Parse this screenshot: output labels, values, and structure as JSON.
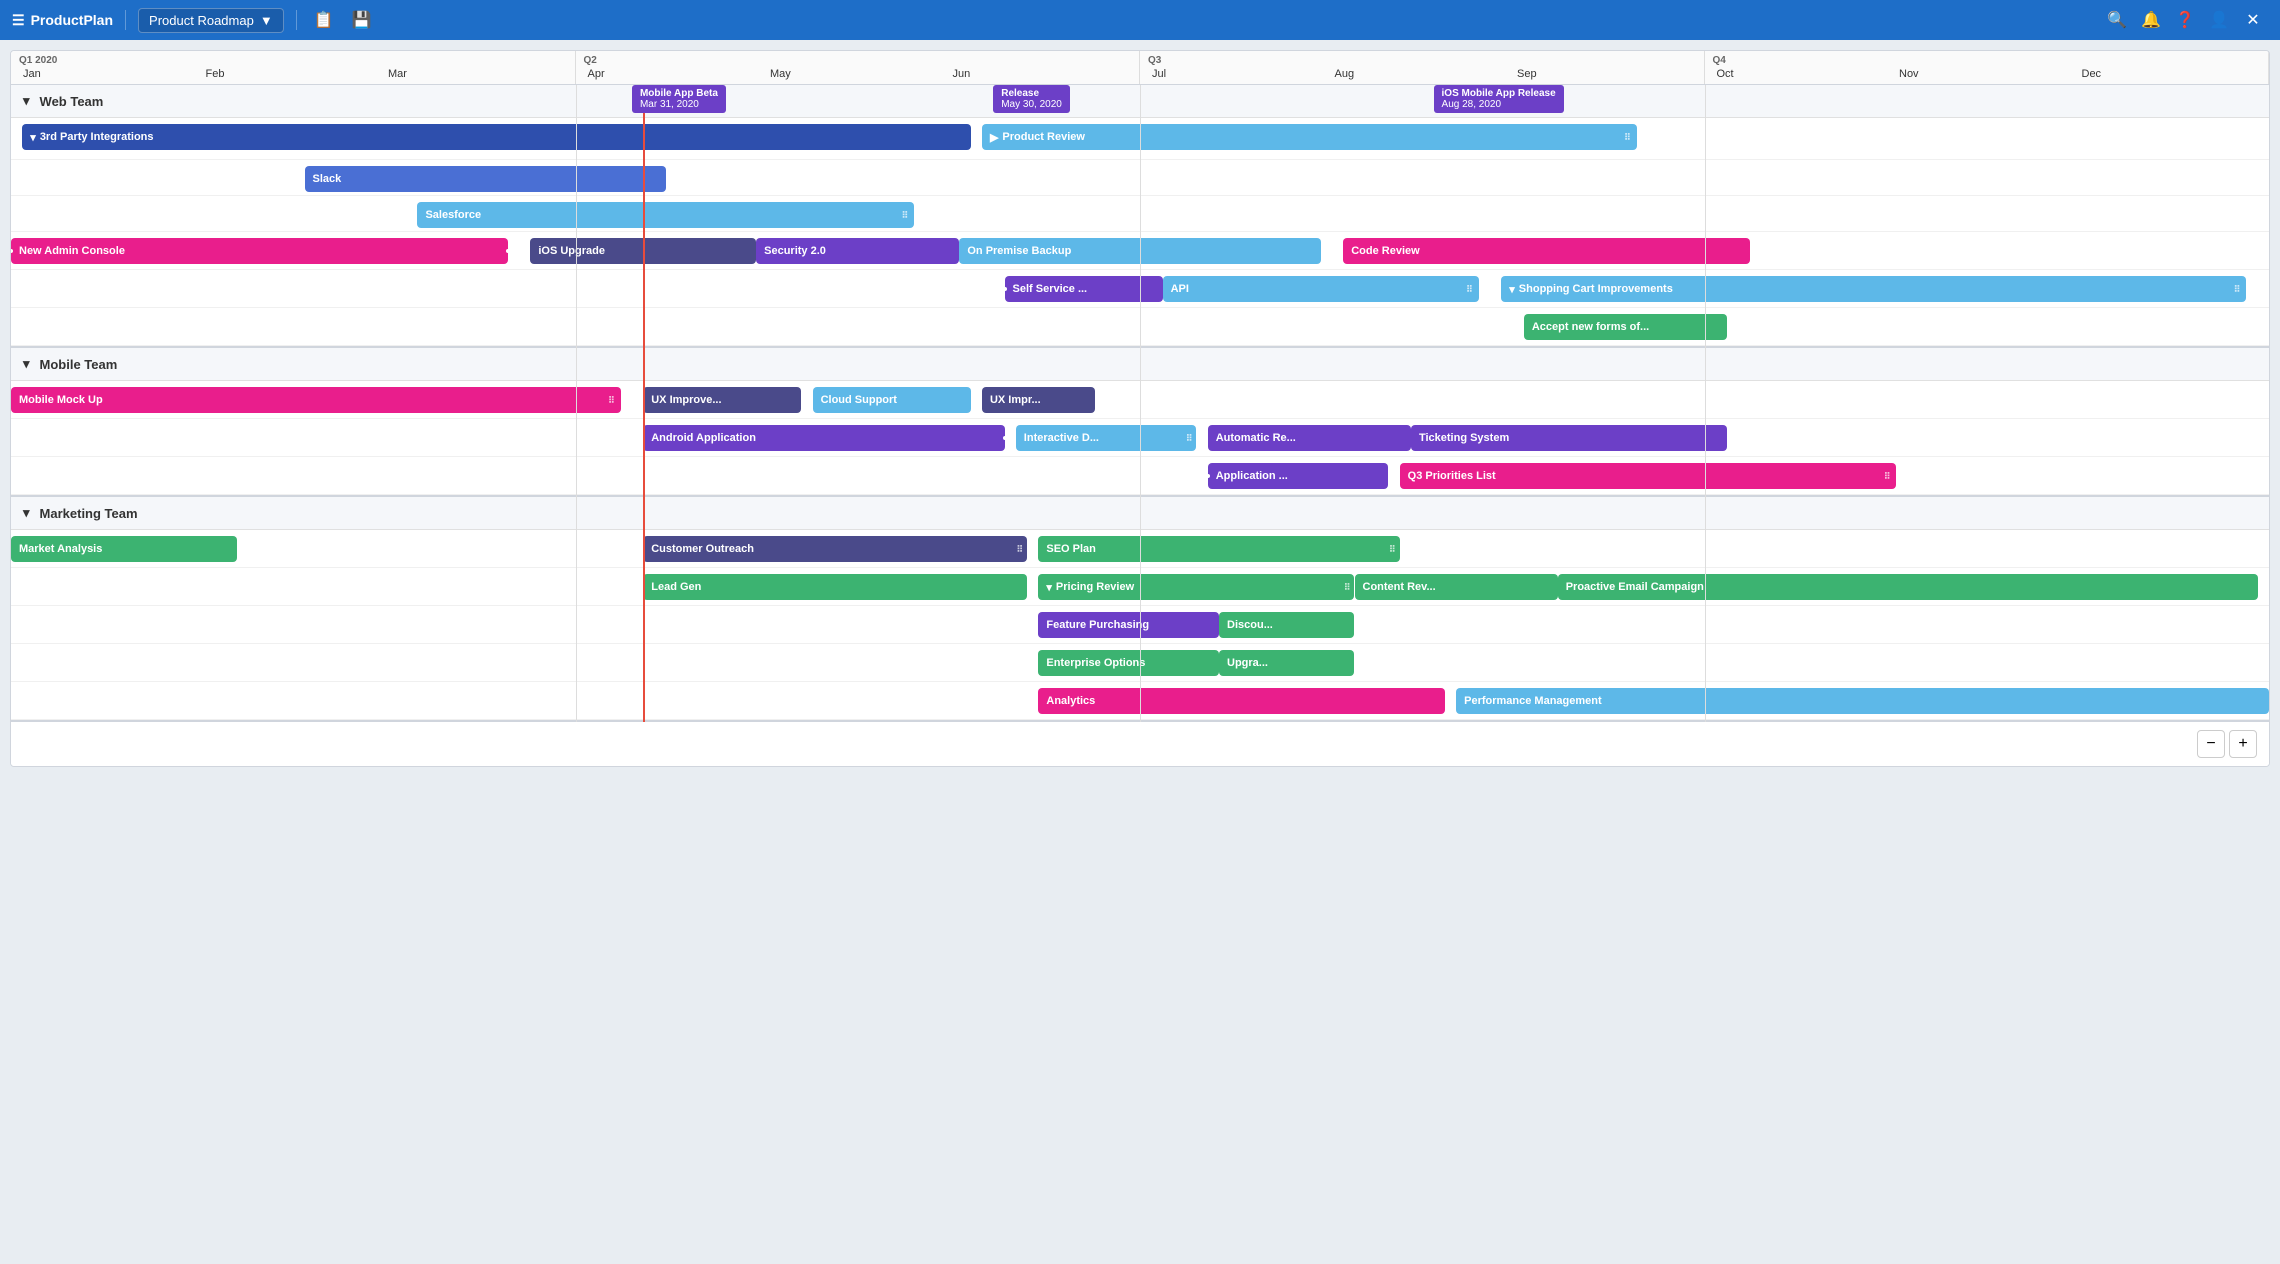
{
  "app": {
    "logo": "ProductPlan",
    "current_plan": "Product Roadmap"
  },
  "nav": {
    "copy_label": "📋",
    "save_label": "💾",
    "search_label": "🔍",
    "notifications_label": "🔔",
    "help_label": "❓",
    "user_label": "👤",
    "close_label": "✕"
  },
  "timeline": {
    "quarters": [
      {
        "label": "Q1 2020",
        "months": [
          "Jan",
          "Feb",
          "Mar"
        ]
      },
      {
        "label": "Q2",
        "months": [
          "Apr",
          "May",
          "Jun"
        ]
      },
      {
        "label": "Q3",
        "months": [
          "Jul",
          "Aug",
          "Sep"
        ]
      },
      {
        "label": "Q4",
        "months": [
          "Oct",
          "Nov",
          "Dec"
        ]
      }
    ]
  },
  "sections": [
    {
      "id": "web-team",
      "title": "Web Team",
      "collapsed": false
    },
    {
      "id": "mobile-team",
      "title": "Mobile Team",
      "collapsed": false
    },
    {
      "id": "marketing-team",
      "title": "Marketing Team",
      "collapsed": false
    }
  ],
  "milestones": [
    {
      "id": "release",
      "label": "Release",
      "date": "May 30, 2020",
      "color": "#6c3fc7"
    },
    {
      "id": "mobile-beta",
      "label": "Mobile App Beta",
      "date": "Mar 31, 2020",
      "color": "#6c3fc7"
    },
    {
      "id": "ios-release",
      "label": "iOS Mobile App Release",
      "date": "Aug 28, 2020",
      "color": "#6c3fc7"
    }
  ],
  "bars": {
    "web_team": [
      {
        "row": 0,
        "label": "3rd Party Integrations",
        "color": "#2e4fad",
        "left_pct": 0,
        "width_pct": 44,
        "collapse_icon": true,
        "sub_bars": [
          {
            "label": "Slack",
            "color": "#4a6fd4",
            "left_pct": 13,
            "width_pct": 16
          },
          {
            "label": "Salesforce",
            "color": "#5db8e8",
            "left_pct": 18,
            "width_pct": 21
          }
        ]
      },
      {
        "row": 0,
        "label": "Product Review",
        "color": "#5db8e8",
        "left_pct": 44,
        "width_pct": 28,
        "has_handle": true
      },
      {
        "row": 2,
        "label": "New Admin Console",
        "color": "#e91e8c",
        "left_pct": 0,
        "width_pct": 23,
        "has_dot_right": true,
        "has_dot_left": true
      },
      {
        "row": 2,
        "label": "iOS Upgrade",
        "color": "#4a4a8a",
        "left_pct": 23,
        "width_pct": 10
      },
      {
        "row": 2,
        "label": "Security 2.0",
        "color": "#6c3fc7",
        "left_pct": 33,
        "width_pct": 9
      },
      {
        "row": 2,
        "label": "On Premise Backup",
        "color": "#5db8e8",
        "left_pct": 42,
        "width_pct": 16
      },
      {
        "row": 2,
        "label": "Code Review",
        "color": "#e91e8c",
        "left_pct": 59,
        "width_pct": 18
      },
      {
        "row": 3,
        "label": "Self Service ...",
        "color": "#6c3fc7",
        "left_pct": 44,
        "width_pct": 7
      },
      {
        "row": 3,
        "label": "API",
        "color": "#5db8e8",
        "left_pct": 51,
        "width_pct": 14,
        "has_handle": true
      },
      {
        "row": 3,
        "label": "Shopping Cart Improvements",
        "color": "#5db8e8",
        "left_pct": 67,
        "width_pct": 33,
        "collapse_icon": true,
        "has_handle": true,
        "sub_bars": [
          {
            "label": "Accept new forms of...",
            "color": "#3cb371",
            "left_pct": 67.5,
            "width_pct": 9
          }
        ]
      }
    ],
    "mobile_team": [
      {
        "row": 0,
        "label": "Mobile Mock Up",
        "color": "#e91e8c",
        "left_pct": 0,
        "width_pct": 27,
        "has_handle": true
      },
      {
        "row": 0,
        "label": "UX Improve...",
        "color": "#4a4a8a",
        "left_pct": 28,
        "width_pct": 7
      },
      {
        "row": 0,
        "label": "Cloud Support",
        "color": "#5db8e8",
        "left_pct": 35,
        "width_pct": 7
      },
      {
        "row": 0,
        "label": "UX Impr...",
        "color": "#4a4a8a",
        "left_pct": 42,
        "width_pct": 6
      },
      {
        "row": 1,
        "label": "Android Application",
        "color": "#6c3fc7",
        "left_pct": 28,
        "width_pct": 17,
        "has_dot_right": true,
        "has_dot_left": true
      },
      {
        "row": 1,
        "label": "Interactive D...",
        "color": "#5db8e8",
        "left_pct": 45,
        "width_pct": 8,
        "has_handle": true
      },
      {
        "row": 1,
        "label": "Automatic Re...",
        "color": "#6c3fc7",
        "left_pct": 53,
        "width_pct": 9
      },
      {
        "row": 1,
        "label": "Ticketing System",
        "color": "#6c3fc7",
        "left_pct": 62,
        "width_pct": 14
      },
      {
        "row": 2,
        "label": "Application ...",
        "color": "#6c3fc7",
        "left_pct": 53,
        "width_pct": 8,
        "has_dot_left": true
      },
      {
        "row": 2,
        "label": "Q3 Priorities List",
        "color": "#e91e8c",
        "left_pct": 61,
        "width_pct": 22,
        "has_handle": true
      }
    ],
    "marketing_team": [
      {
        "row": 0,
        "label": "Market Analysis",
        "color": "#3cb371",
        "left_pct": 0,
        "width_pct": 10
      },
      {
        "row": 0,
        "label": "Customer Outreach",
        "color": "#4a4a8a",
        "left_pct": 28,
        "width_pct": 17,
        "has_handle": true
      },
      {
        "row": 0,
        "label": "SEO Plan",
        "color": "#3cb371",
        "left_pct": 45,
        "width_pct": 16,
        "has_handle": true
      },
      {
        "row": 1,
        "label": "Lead Gen",
        "color": "#3cb371",
        "left_pct": 28,
        "width_pct": 17
      },
      {
        "row": 1,
        "label": "Pricing Review",
        "color": "#3cb371",
        "left_pct": 45,
        "width_pct": 14,
        "collapse_icon": true,
        "sub_bars": [
          {
            "label": "Feature Purchasing",
            "color": "#6c3fc7",
            "left_pct": 45.5,
            "width_pct": 8
          },
          {
            "label": "Discou...",
            "color": "#3cb371",
            "left_pct": 53.5,
            "width_pct": 6
          },
          {
            "label": "Enterprise Options",
            "color": "#3cb371",
            "left_pct": 45.5,
            "width_pct": 8
          },
          {
            "label": "Upgra...",
            "color": "#3cb371",
            "left_pct": 53.5,
            "width_pct": 6
          }
        ]
      },
      {
        "row": 1,
        "label": "Content Rev...",
        "color": "#3cb371",
        "left_pct": 59,
        "width_pct": 9
      },
      {
        "row": 1,
        "label": "Proactive Email Campaign",
        "color": "#3cb371",
        "left_pct": 68,
        "width_pct": 32
      },
      {
        "row": 4,
        "label": "Analytics",
        "color": "#e91e8c",
        "left_pct": 45,
        "width_pct": 18
      },
      {
        "row": 4,
        "label": "Performance Management",
        "color": "#5db8e8",
        "left_pct": 65,
        "width_pct": 35
      }
    ]
  },
  "zoom": {
    "minus_label": "−",
    "plus_label": "+"
  }
}
